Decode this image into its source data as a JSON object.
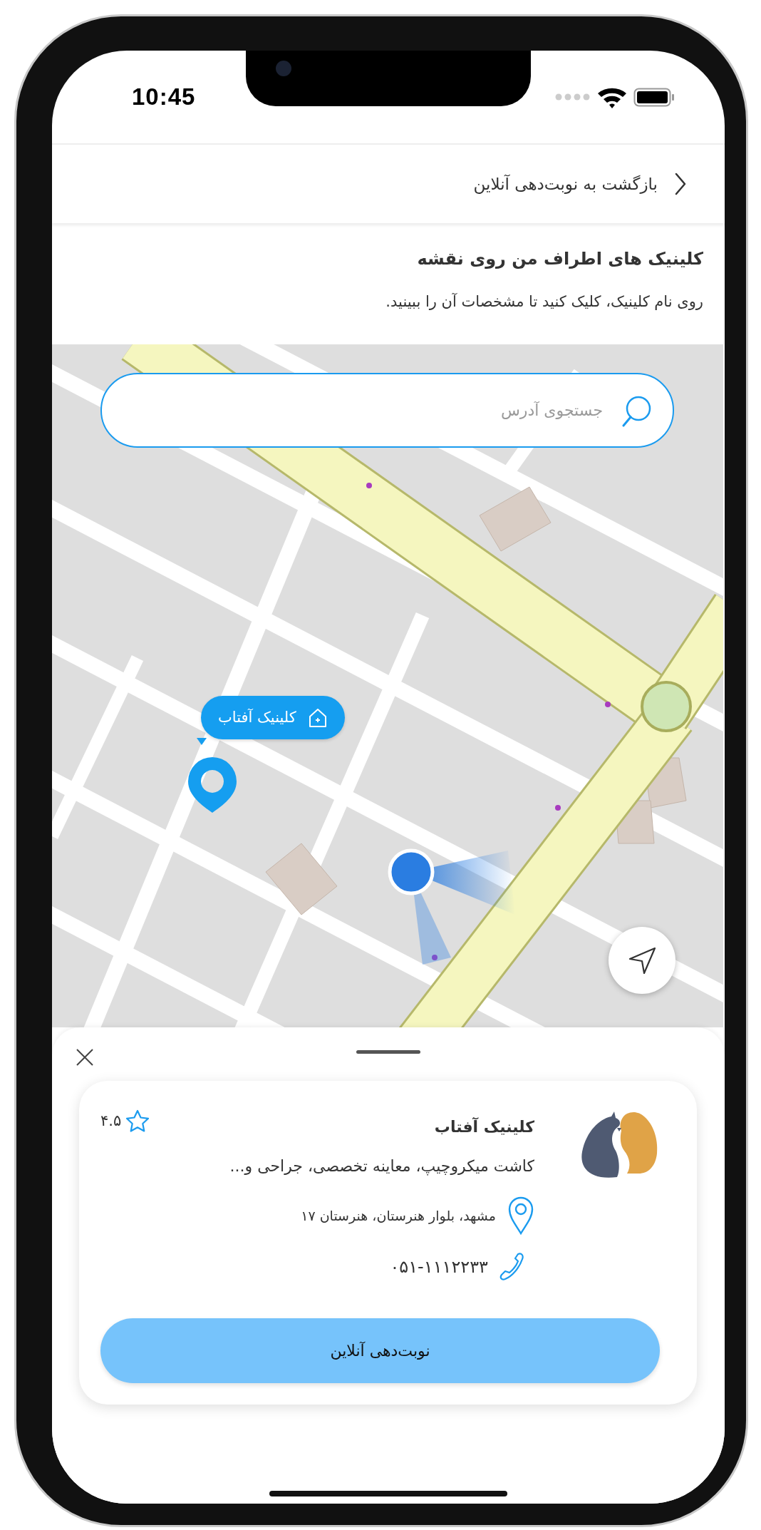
{
  "status_bar": {
    "time": "10:45"
  },
  "header": {
    "back_label": "بازگشت به نوبت‌دهی آنلاین"
  },
  "page": {
    "title": "کلینیک های اطراف من روی نقشه",
    "subtitle": "روی نام کلینیک، کلیک کنید تا مشخصات آن را ببینید."
  },
  "map": {
    "search": {
      "placeholder": "جستجوی آدرس"
    },
    "markers": [
      {
        "label": "کلینیک آفتاب"
      }
    ]
  },
  "clinic_card": {
    "name": "کلینیک آفتاب",
    "rating": "۴.۵",
    "services": "کاشت میکروچیپ، معاینه تخصصی، جراحی و...",
    "address": "مشهد، بلوار هنرستان، هنرستان ۱۷",
    "phone": "۰۵۱-۱۱۱۲۲۳۳",
    "button": "نوبت‌دهی آنلاین"
  }
}
